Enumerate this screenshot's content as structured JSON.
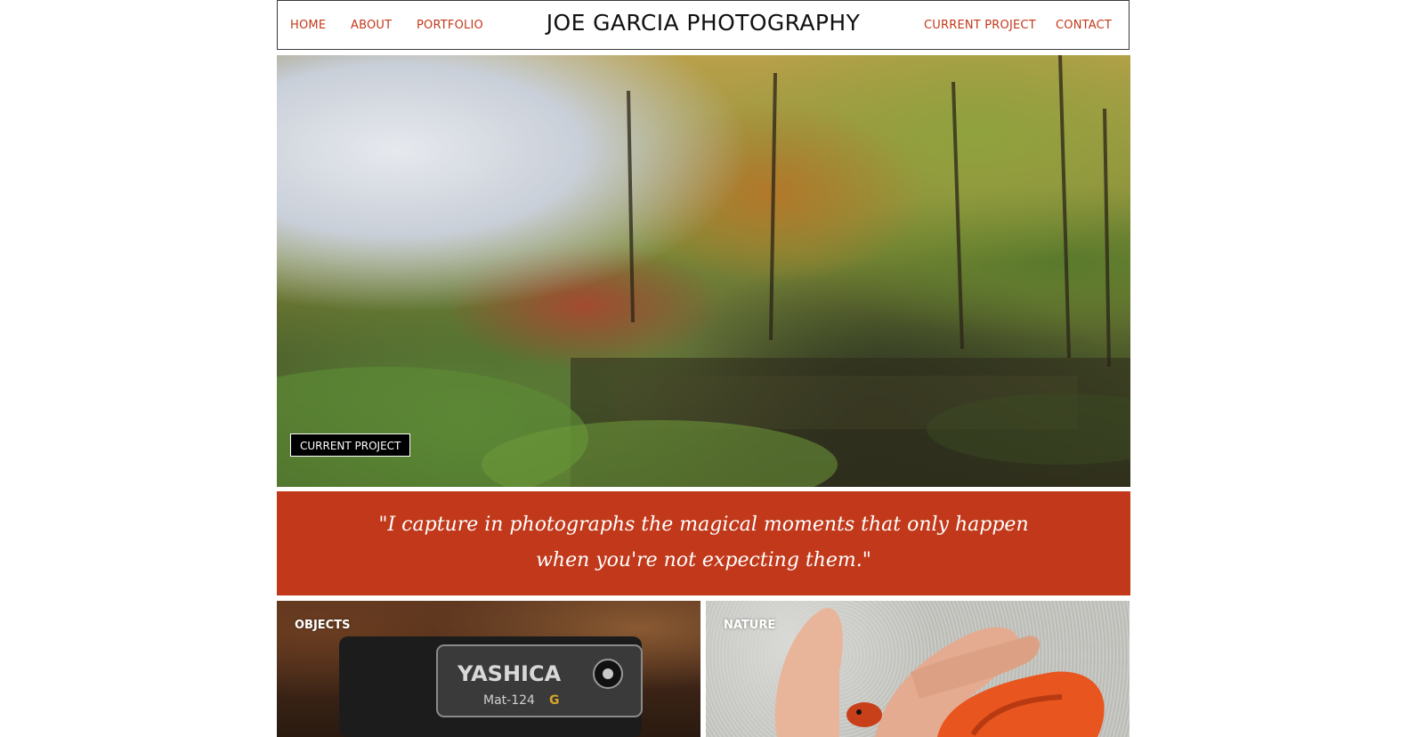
{
  "header": {
    "title": "JOE GARCIA PHOTOGRAPHY",
    "nav_left": [
      {
        "label": "HOME"
      },
      {
        "label": "ABOUT"
      },
      {
        "label": "PORTFOLIO"
      }
    ],
    "nav_right": [
      {
        "label": "CURRENT PROJECT"
      },
      {
        "label": "CONTACT"
      }
    ]
  },
  "hero": {
    "button_label": "CURRENT PROJECT"
  },
  "quote": {
    "text": "\"I capture in photographs the magical moments that only happen when you're not expecting them.\""
  },
  "tiles": [
    {
      "label": "OBJECTS",
      "camera_brand": "YASHICA",
      "camera_model": "Mat-124",
      "camera_badge": "G"
    },
    {
      "label": "NATURE"
    }
  ],
  "colors": {
    "accent": "#c1381a",
    "title_text": "#111111",
    "header_border": "#3a3a3a"
  }
}
